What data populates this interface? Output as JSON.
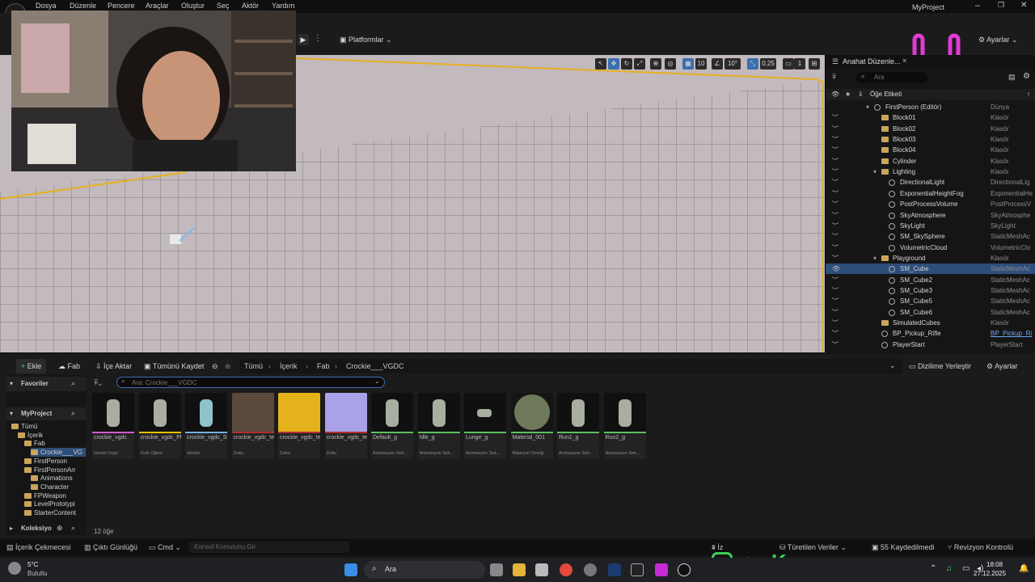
{
  "app": {
    "project_name": "MyProject"
  },
  "menu": [
    "Dosya",
    "Düzenle",
    "Pencere",
    "Araçlar",
    "Oluştur",
    "Seç",
    "Aktör",
    "Yardım"
  ],
  "toolbar": {
    "platforms_label": "Platformlar",
    "settings_label": "Ayarlar"
  },
  "viewport_toolbar": {
    "grid_snap": "10",
    "rotation_snap": "10°",
    "scale_snap": "0,25",
    "camera_speed": "1"
  },
  "outliner": {
    "tab_title": "Anahat Düzenle...",
    "search_placeholder": "Ara",
    "header_label": "Öğe Etiketi",
    "header_type": "r",
    "rows": [
      {
        "label": "FirstPerson (Editör)",
        "type": "Dünya",
        "kind": "world",
        "indent": 0
      },
      {
        "label": "Block01",
        "type": "Klasör",
        "kind": "folder",
        "indent": 1
      },
      {
        "label": "Block02",
        "type": "Klasör",
        "kind": "folder",
        "indent": 1
      },
      {
        "label": "Block03",
        "type": "Klasör",
        "kind": "folder",
        "indent": 1
      },
      {
        "label": "Block04",
        "type": "Klasör",
        "kind": "folder",
        "indent": 1
      },
      {
        "label": "Cylinder",
        "type": "Klasör",
        "kind": "folder",
        "indent": 1
      },
      {
        "label": "Lighting",
        "type": "Klasör",
        "kind": "folder",
        "indent": 1
      },
      {
        "label": "DirectionalLight",
        "type": "DirectionalLig",
        "kind": "actor",
        "indent": 2
      },
      {
        "label": "ExponentialHeightFog",
        "type": "ExponentialHe",
        "kind": "actor",
        "indent": 2
      },
      {
        "label": "PostProcessVolume",
        "type": "PostProcessV",
        "kind": "actor",
        "indent": 2
      },
      {
        "label": "SkyAtmosphere",
        "type": "SkyAtmosphe",
        "kind": "actor",
        "indent": 2
      },
      {
        "label": "SkyLight",
        "type": "SkyLight",
        "kind": "actor",
        "indent": 2
      },
      {
        "label": "SM_SkySphere",
        "type": "StaticMeshAc",
        "kind": "actor",
        "indent": 2
      },
      {
        "label": "VolumetricCloud",
        "type": "VolumetricClo",
        "kind": "actor",
        "indent": 2
      },
      {
        "label": "Playground",
        "type": "Klasör",
        "kind": "folder",
        "indent": 1
      },
      {
        "label": "SM_Cube",
        "type": "StaticMeshAc",
        "kind": "actor",
        "indent": 2,
        "selected": true
      },
      {
        "label": "SM_Cube2",
        "type": "StaticMeshAc",
        "kind": "actor",
        "indent": 2
      },
      {
        "label": "SM_Cube3",
        "type": "StaticMeshAc",
        "kind": "actor",
        "indent": 2
      },
      {
        "label": "SM_Cube5",
        "type": "StaticMeshAc",
        "kind": "actor",
        "indent": 2
      },
      {
        "label": "SM_Cube6",
        "type": "StaticMeshAc",
        "kind": "actor",
        "indent": 2
      },
      {
        "label": "SimulatedCubes",
        "type": "Klasör",
        "kind": "folder",
        "indent": 1
      },
      {
        "label": "BP_Pickup_Rifle",
        "type": "BP_Pickup_Ri",
        "kind": "actor",
        "indent": 1,
        "link": true
      },
      {
        "label": "PlayerStart",
        "type": "PlayerStart",
        "kind": "actor",
        "indent": 1
      }
    ]
  },
  "content_browser": {
    "add_label": "Ekle",
    "fab_label": "Fab",
    "import_label": "İçe Aktar",
    "save_all_label": "Tümünü Kaydet",
    "breadcrumb": [
      "Tümü",
      "İçerik",
      "Fab",
      "Crockie___VGDC"
    ],
    "dock_label": "Dizilime Yerleştir",
    "settings_label": "Ayarlar",
    "search_placeholder": "Ara: Crockie___VGDC",
    "favorites_label": "Favoriler",
    "project_label": "MyProject",
    "collections_label": "Koleksiyo",
    "item_count": "12 öğe",
    "tree": [
      {
        "label": "Tümü",
        "indent": 0
      },
      {
        "label": "İçerik",
        "indent": 1
      },
      {
        "label": "Fab",
        "indent": 2
      },
      {
        "label": "Crockie___VG",
        "indent": 3,
        "selected": true
      },
      {
        "label": "FirstPerson",
        "indent": 2
      },
      {
        "label": "FirstPersonArr",
        "indent": 2
      },
      {
        "label": "Animations",
        "indent": 3
      },
      {
        "label": "Character",
        "indent": 3
      },
      {
        "label": "FPWeapon",
        "indent": 2
      },
      {
        "label": "LevelPrototypi",
        "indent": 2
      },
      {
        "label": "StarterContent",
        "indent": 2
      }
    ],
    "assets": [
      {
        "name": "crockie_vgdc",
        "type": "İskelet Örgü",
        "color": "#d05ad0",
        "thumb": "character"
      },
      {
        "name": "crockie_vgdc_PhysicsAsset",
        "type": "Fizik Öğesi",
        "color": "#e6c100",
        "thumb": "character"
      },
      {
        "name": "crockie_vgdc_Skeleton",
        "type": "İskelet",
        "color": "#6fb0e0",
        "thumb": "character-blue"
      },
      {
        "name": "crockie_vgdc_texture_0",
        "type": "Doku",
        "color": "#b03030",
        "thumb": "texture-mosaic"
      },
      {
        "name": "crockie_vgdc_texture_1",
        "type": "Doku",
        "color": "#b03030",
        "thumb": "texture-yellow"
      },
      {
        "name": "crockie_vgdc_texture_2",
        "type": "Doku",
        "color": "#b03030",
        "thumb": "texture-normal"
      },
      {
        "name": "Default_g",
        "type": "Animasyon Sek...",
        "color": "#5cc05c",
        "thumb": "character"
      },
      {
        "name": "Idle_g",
        "type": "Animasyon Sek...",
        "color": "#5cc05c",
        "thumb": "character"
      },
      {
        "name": "Lunge_g",
        "type": "Animasyon Sek...",
        "color": "#5cc05c",
        "thumb": "character-small"
      },
      {
        "name": "Material_001",
        "type": "Materyal Örneği",
        "color": "#5cc05c",
        "thumb": "sphere"
      },
      {
        "name": "Run1_g",
        "type": "Animasyon Sek...",
        "color": "#5cc05c",
        "thumb": "character"
      },
      {
        "name": "Run2_g",
        "type": "Animasyon Sek...",
        "color": "#5cc05c",
        "thumb": "character"
      }
    ]
  },
  "statusbar": {
    "content_drawer": "İçerik Çekmecesi",
    "output_log": "Çıktı Günlüğü",
    "cmd_label": "Cmd",
    "console_placeholder": "Konsol Komutunu Gir",
    "trace_label": "İz",
    "derived_data": "Türetilen Veriler",
    "unsaved": "55 Kaydedilmedi",
    "revision": "Revizyon Kontrolü"
  },
  "taskbar": {
    "weather_temp": "5°C",
    "weather_desc": "Bulutlu",
    "search_label": "Ara",
    "time": "18:08",
    "date": "27.12.2025"
  }
}
